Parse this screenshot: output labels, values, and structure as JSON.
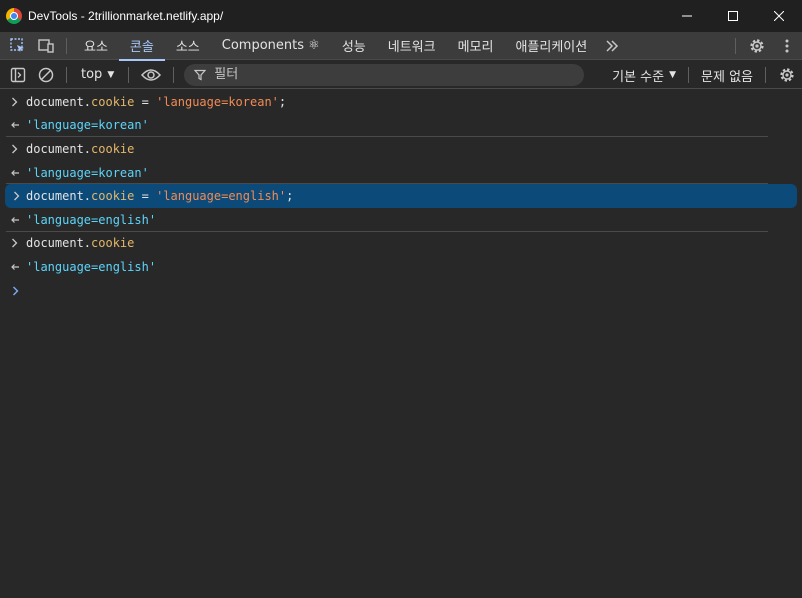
{
  "window": {
    "title": "DevTools - 2trillionmarket.netlify.app/"
  },
  "tabs": [
    {
      "label": "요소"
    },
    {
      "label": "콘솔"
    },
    {
      "label": "소스"
    },
    {
      "label": "Components ⚛"
    },
    {
      "label": "성능"
    },
    {
      "label": "네트워크"
    },
    {
      "label": "메모리"
    },
    {
      "label": "애플리케이션"
    }
  ],
  "console_toolbar": {
    "context": "top",
    "filter_placeholder": "필터",
    "levels": "기본 수준",
    "issues": "문제 없음"
  },
  "messages": [
    {
      "kind": "input",
      "parts": [
        {
          "c": "plain",
          "t": "document."
        },
        {
          "c": "prop",
          "t": "cookie"
        },
        {
          "c": "plain",
          "t": " = "
        },
        {
          "c": "str",
          "t": "'language=korean'"
        },
        {
          "c": "plain",
          "t": ";"
        }
      ]
    },
    {
      "kind": "result",
      "parts": [
        {
          "c": "res",
          "t": "'language=korean'"
        }
      ]
    },
    {
      "kind": "input",
      "parts": [
        {
          "c": "plain",
          "t": "document."
        },
        {
          "c": "prop",
          "t": "cookie"
        }
      ]
    },
    {
      "kind": "result",
      "parts": [
        {
          "c": "res",
          "t": "'language=korean'"
        }
      ]
    },
    {
      "kind": "input",
      "parts": [
        {
          "c": "plain",
          "t": "document."
        },
        {
          "c": "prop",
          "t": "cookie"
        },
        {
          "c": "plain",
          "t": " = "
        },
        {
          "c": "str",
          "t": "'language=english'"
        },
        {
          "c": "plain",
          "t": ";"
        }
      ],
      "highlighted": true
    },
    {
      "kind": "result",
      "parts": [
        {
          "c": "res",
          "t": "'language=english'"
        }
      ]
    },
    {
      "kind": "input",
      "parts": [
        {
          "c": "plain",
          "t": "document."
        },
        {
          "c": "prop",
          "t": "cookie"
        }
      ]
    },
    {
      "kind": "result",
      "parts": [
        {
          "c": "res",
          "t": "'language=english'"
        }
      ]
    }
  ],
  "colors": {
    "accent": "#a8c7fa",
    "highlight": "#0c4a7a",
    "property": "#e5b76a",
    "string": "#f28b54",
    "result": "#5cd5fb"
  },
  "icons": {
    "chrome": "chrome-logo-icon",
    "minimize": "minimize-icon",
    "maximize": "maximize-icon",
    "close": "close-icon",
    "inspect": "inspect-element-icon",
    "device": "device-toolbar-icon",
    "more_tabs": "chevron-double-right-icon",
    "settings": "gear-icon",
    "menu": "kebab-menu-icon",
    "sidebar": "sidebar-toggle-icon",
    "clear": "clear-console-icon",
    "eye": "eye-icon",
    "filter": "filter-icon",
    "input_prompt": "chevron-right-icon",
    "result_arrow": "return-arrow-icon"
  }
}
